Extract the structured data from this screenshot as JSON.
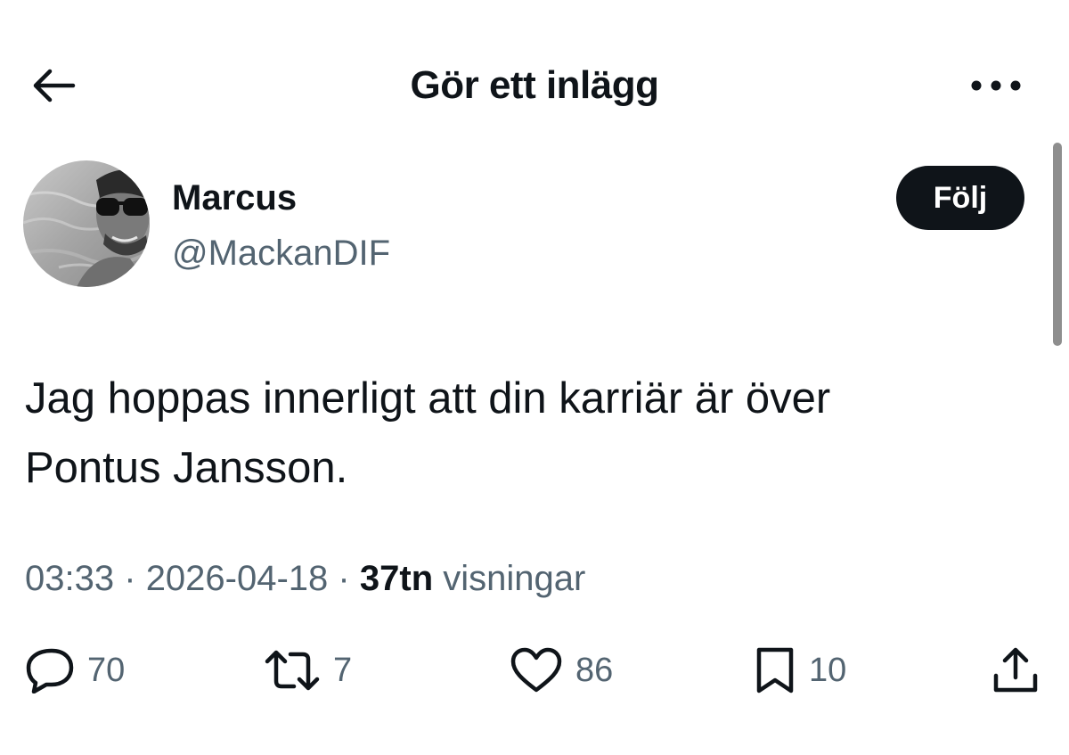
{
  "header": {
    "title": "Gör ett inlägg",
    "back_icon": "arrow-left-icon",
    "more_icon": "more-horizontal-icon"
  },
  "author": {
    "name": "Marcus",
    "handle": "@MackanDIF",
    "follow_label": "Följ"
  },
  "tweet": {
    "text_line1": "Jag hoppas innerligt att din karriär är över",
    "text_line2": "Pontus Jansson."
  },
  "meta": {
    "time": "03:33",
    "separator": "·",
    "date": "2026-04-18",
    "views_count": "37tn",
    "views_label": "visningar"
  },
  "actions": {
    "replies": "70",
    "reposts": "7",
    "likes": "86",
    "bookmarks": "10"
  },
  "colors": {
    "text_primary": "#0f1419",
    "text_secondary": "#536471",
    "follow_bg": "#0f1419",
    "background": "#ffffff"
  }
}
